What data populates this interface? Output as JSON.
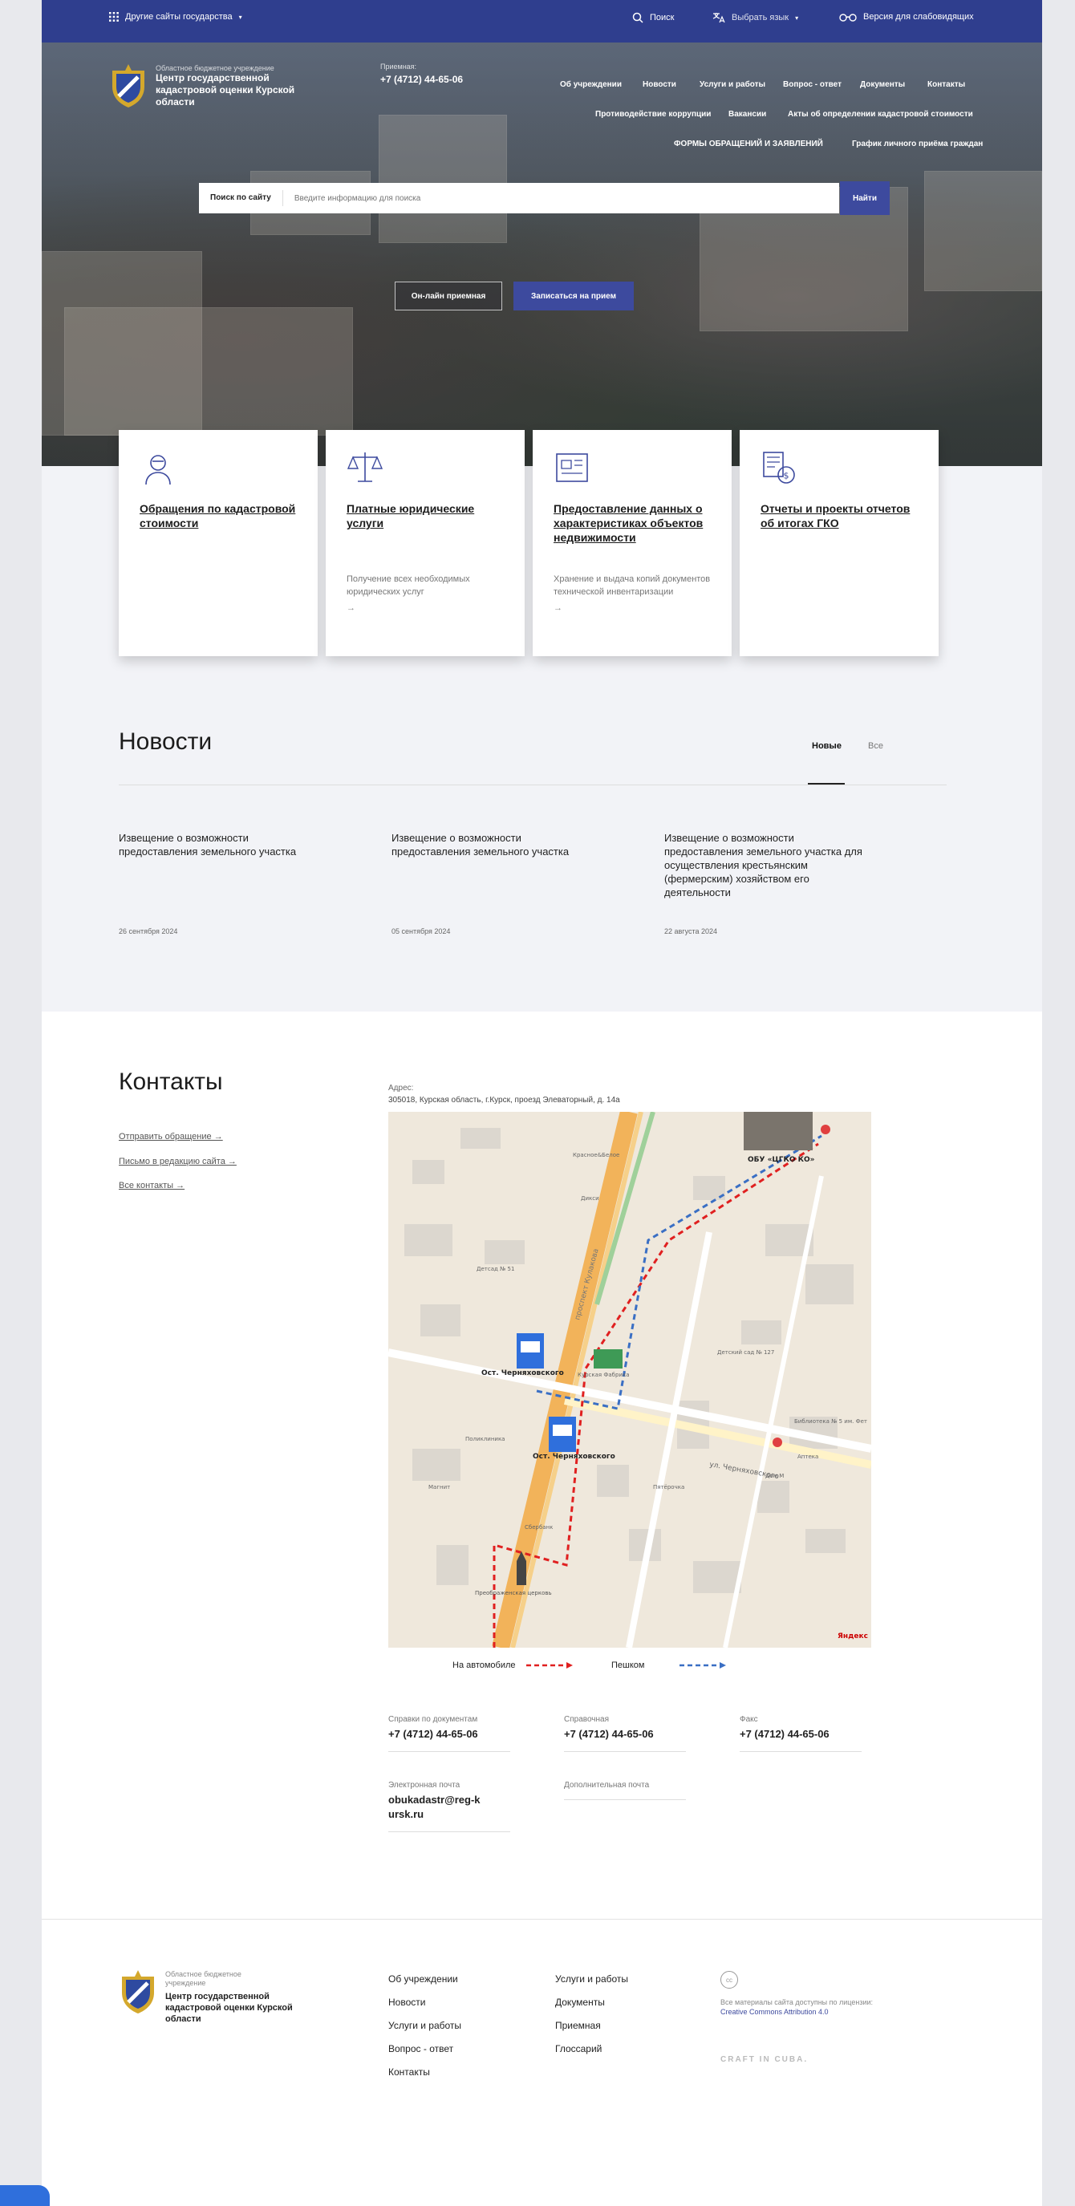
{
  "topbar": {
    "other_sites": "Другие сайты государства",
    "search": "Поиск",
    "language": "Выбрать язык",
    "accessibility": "Версия для слабовидящих"
  },
  "header": {
    "org_sub": "Областное бюджетное учреждение",
    "org_name": "Центр государственной кадастровой оценки Курской области",
    "reception_label": "Приемная:",
    "reception_phone": "+7 (4712) 44-65-06"
  },
  "nav": {
    "items": [
      "Об учреждении",
      "Новости",
      "Услуги и работы",
      "Вопрос - ответ",
      "Документы",
      "Контакты",
      "Противодействие коррупции",
      "Вакансии",
      "Акты об определении кадастровой стоимости",
      "ФОРМЫ ОБРАЩЕНИЙ И ЗАЯВЛЕНИЙ",
      "График личного приёма граждан"
    ]
  },
  "search": {
    "label": "Поиск по сайту",
    "placeholder": "Введите информацию для поиска",
    "button": "Найти"
  },
  "hero_buttons": {
    "online": "Он-лайн приемная",
    "appointment": "Записаться на прием"
  },
  "cards": [
    {
      "title": "Обращения по кадастровой стоимости",
      "desc": "",
      "arrow": ""
    },
    {
      "title": "Платные юридические услуги",
      "desc": "Получение всех необходимых юридических услуг",
      "arrow": "→"
    },
    {
      "title": "Предоставление данных о характеристиках объектов недвижимости",
      "desc": "Хранение и выдача копий документов технической инвентаризации",
      "arrow": "→"
    },
    {
      "title": "Отчеты и проекты отчетов об итогах ГКО",
      "desc": "",
      "arrow": ""
    }
  ],
  "news": {
    "title": "Новости",
    "tab_new": "Новые",
    "tab_all": "Все",
    "items": [
      {
        "title": "Извещение о возможности предоставления земельного участка",
        "date": "26 сентября 2024"
      },
      {
        "title": "Извещение о возможности предоставления земельного участка",
        "date": "05 сентября 2024"
      },
      {
        "title": "Извещение о возможности предоставления земельного участка для осуществления крестьянским (фермерским) хозяйством его деятельности",
        "date": "22 августа 2024"
      }
    ]
  },
  "contacts": {
    "title": "Контакты",
    "links": [
      "Отправить обращение →",
      "Письмо в редакцию сайта →",
      "Все контакты →"
    ],
    "address_label": "Адрес:",
    "address": "305018, Курская область, г.Курск, проезд Элеваторный, д. 14а",
    "legend_car": "На автомобиле",
    "legend_walk": "Пешком",
    "map": {
      "stop1": "Ост. Черняховского",
      "stop2": "Ост. Черняховского",
      "office": "ОБУ «ЦГКО КО»",
      "street1": "проспект Кулакова",
      "street2": "ул. Черняховского",
      "church": "Преображенская церковь",
      "yandex": "Яндекс",
      "labels": [
        "Детсад № 51",
        "Детский сад № 127",
        "Библиотека № 5 им. Фет",
        "Дикси",
        "Пятёрочка",
        "Красное&Белое",
        "Магнит",
        "Сбербанк",
        "Курская Фабрика",
        "Поликлиника",
        "Аптека",
        "Дом М"
      ]
    },
    "info": [
      {
        "label": "Справки по документам",
        "value": "+7 (4712) 44-65-06"
      },
      {
        "label": "Справочная",
        "value": "+7 (4712) 44-65-06"
      },
      {
        "label": "Факс",
        "value": "+7 (4712) 44-65-06"
      },
      {
        "label": "Электронная почта",
        "value": "obukadastr@reg-kursk.ru"
      },
      {
        "label": "Дополнительная почта",
        "value": ""
      }
    ]
  },
  "footer": {
    "org_sub": "Областное бюджетное учреждение",
    "org_name": "Центр государственной кадастровой оценки Курской области",
    "col1": [
      "Об учреждении",
      "Новости",
      "Услуги и работы",
      "Вопрос - ответ",
      "Контакты"
    ],
    "col2": [
      "Услуги и работы",
      "Документы",
      "Приемная",
      "Глоссарий"
    ],
    "cc": "cc",
    "license_text": "Все материалы сайта доступны по лицензии:",
    "license_name": "Creative Commons Attribution 4.0",
    "craft": "CRAFT IN CUBA."
  },
  "colors": {
    "brand": "#2f3e8e",
    "accent": "#3d4a9e",
    "route_car": "#e02020",
    "route_walk": "#3a6fc4"
  }
}
